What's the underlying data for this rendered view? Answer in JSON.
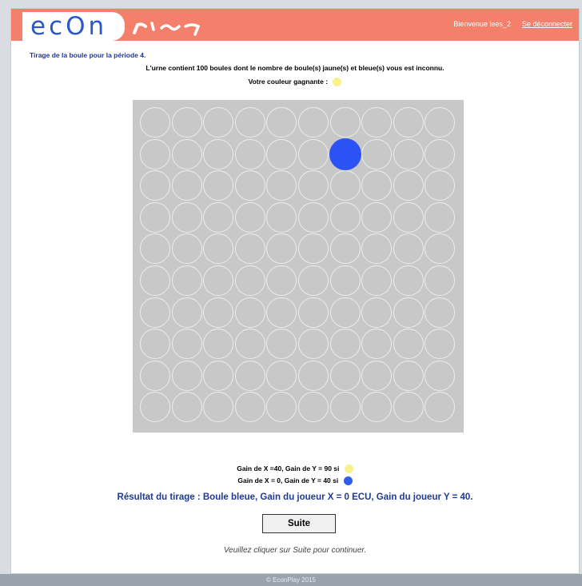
{
  "header": {
    "logo_text": "ecOn",
    "logo_script": "play",
    "welcome": "Bienvenue lees_2",
    "logout": "Se déconnecter",
    "accent_color": "#f47f6b",
    "logo_color": "#2b58c7"
  },
  "page": {
    "period_title": "Tirage de la boule pour la période 4.",
    "urn_description": "L'urne contient 100 boules dont le nombre de boule(s) jaune(s) et bleue(s) vous est inconnu.",
    "winning_color_label": "Votre couleur gagnante :",
    "winning_color": "yellow"
  },
  "urn": {
    "rows": 10,
    "cols": 10,
    "drawn_ball": {
      "row": 2,
      "col": 7,
      "color": "blue"
    }
  },
  "legend": {
    "yellow_line": "Gain de X =40, Gain de Y = 90 si",
    "blue_line": "Gain de X = 0, Gain de Y = 40 si"
  },
  "result": {
    "text": "Résultat du tirage : Boule bleue, Gain du joueur X = 0 ECU, Gain du joueur Y = 40."
  },
  "actions": {
    "suite_label": "Suite",
    "hint": "Veuillez cliquer sur Suite pour continuer."
  },
  "footer": {
    "text": "© EconPlay 2015"
  },
  "colors": {
    "yellow": "#f7f28c",
    "blue": "#2a52f5",
    "urn_bg": "#c8c8c8"
  }
}
